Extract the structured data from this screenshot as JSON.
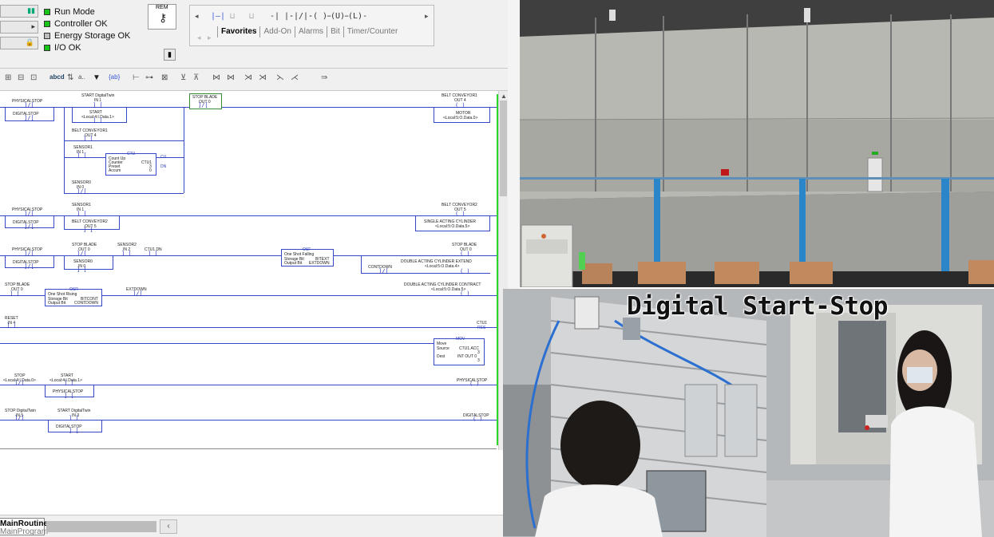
{
  "status": {
    "mode_label": "Run Mode",
    "controller_label": "Controller OK",
    "energy_label": "Energy Storage OK",
    "io_label": "I/O OK",
    "key_label": "REM"
  },
  "toolbar": {
    "tabs": [
      "Favorites",
      "Add-On",
      "Alarms",
      "Bit",
      "Timer/Counter"
    ]
  },
  "ladder": {
    "rung0": {
      "c1_top": "PHYSICALSTOP",
      "c1b_top": "DIGITALSTOP",
      "c2_top": "START DigitalTwin",
      "c2_sub": "IN 1",
      "c2b_top": "START",
      "c2b_sub": "<Local:4:I.Data.1>",
      "c3_top": "STOP BLADE",
      "c3_sub": "OUT 0",
      "coil_top": "BELT CONVEYOR1",
      "coil_sub": "OUT 4",
      "coil_box": "MOTOR",
      "coil_box_sub": "<Local:5:O.Data.0>",
      "b_conv": "BELT CONVEYOR1",
      "b_conv_sub": "OUT 4",
      "sensor1": "SENSOR1",
      "sensor1_sub": "IN 1",
      "ctu_title": "CTU",
      "ctu_l1": "Count Up",
      "ctu_l2": "Counter",
      "ctu_l3": "Preset",
      "ctu_l4": "Accum",
      "ctu_v1": "CTU1",
      "ctu_v2": "3",
      "ctu_v3": "0",
      "ctu_cu": "CU",
      "ctu_dn": "DN",
      "sensor0": "SENSOR0",
      "sensor0_sub": "IN 0"
    },
    "rung1": {
      "c1": "PHYSICALSTOP",
      "c1b": "DIGITALSTOP",
      "c2": "SENSOR1",
      "c2_sub": "IN 1",
      "c2b": "BELT CONVEYOR2",
      "c2b_sub": "OUT 5",
      "coil": "BELT CONVEYOR2",
      "coil_sub": "OUT 5",
      "coil_box": "SINGLE ACTING CYLINDER",
      "coil_box_sub": "<Local:5:O.Data.5>"
    },
    "rung2": {
      "c1": "PHYSICALSTOP",
      "c1b": "DIGITALSTOP",
      "c2": "STOP BLADE",
      "c2_sub": "OUT 0",
      "c2b": "SENSOR0",
      "c2b_sub": "IN 0",
      "c3": "SENSOR2",
      "c3_sub": "IN 2",
      "c4": "CTU1.DN",
      "osr_title": "OSF",
      "osr_l1": "One Shot Falling",
      "osr_l2": "Storage Bit",
      "osr_l3": "Output Bit",
      "osr_v2": "BITEXT",
      "osr_v3": "EXTDOWN",
      "cond": "CONTDOWN",
      "coil": "STOP BLADE",
      "coil_sub": "OUT 0",
      "coil2": "DOUBLE ACTING CYLINDER EXTEND",
      "coil2_sub": "<Local:5:O.Data.4>"
    },
    "rung3": {
      "c1": "STOP BLADE",
      "c1_sub": "OUT 0",
      "osr_title": "OSR",
      "osr_l1": "One Shot Rising",
      "osr_l2": "Storage Bit",
      "osr_l3": "Output Bit",
      "osr_v2": "BITCONT",
      "osr_v3": "CONTDOWN",
      "c2": "EXTDOWN",
      "coil": "DOUBLE ACTING CYLINDER CONTRACT",
      "coil_sub": "<Local:5:O.Data.5>"
    },
    "rung4": {
      "c1": "RESET",
      "c1_sub": "IN 4",
      "coil": "CTU1",
      "coil_tag": "RES"
    },
    "rung5": {
      "mov_title": "MOV",
      "mov_l1": "Move",
      "mov_l2": "Source",
      "mov_l3": "Dest",
      "mov_v2": "CTU1.ACC",
      "mov_v2b": "3",
      "mov_v3": "INT OUT 0",
      "mov_v3b": "3"
    },
    "rung6": {
      "c1": "STOP",
      "c1_sub": "<Local:4:I.Data.0>",
      "c2": "START",
      "c2_sub": "<Local:4:I.Data.1>",
      "c2b": "PHYSICALSTOP",
      "coil": "PHYSICALSTOP"
    },
    "rung7": {
      "c1": "STOP DigitalTwin",
      "c1_sub": "IN 5",
      "c2": "START DigitalTwin",
      "c2_sub": "IN 3",
      "c2b": "DIGITALSTOP",
      "coil": "DIGITALSTOP"
    }
  },
  "bottom": {
    "routine_tab": "MainRoutine",
    "program_tab": "MainProgram"
  },
  "video": {
    "title": "Digital Start-Stop"
  },
  "colors": {
    "rung": "#3548c8",
    "rail": "#2bd62b",
    "led_green": "#19c419"
  }
}
